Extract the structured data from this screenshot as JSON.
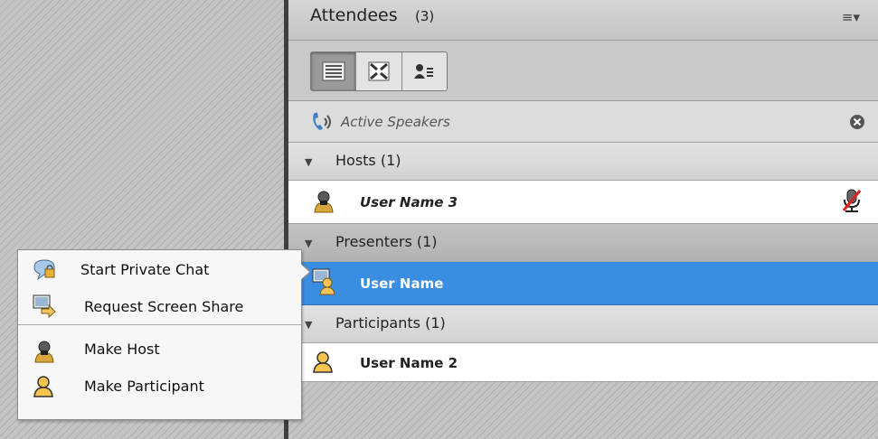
{
  "attendees_pod": {
    "title": "Attendees",
    "count": "(3)",
    "menu_icon": "hamburger-dropdown-icon",
    "view_buttons": [
      {
        "name": "list-view-icon",
        "active": true
      },
      {
        "name": "grid-view-icon",
        "active": false
      },
      {
        "name": "status-view-icon",
        "active": false
      }
    ],
    "active_speakers": {
      "label": "Active Speakers",
      "icon": "phone-speaker-icon"
    },
    "sections": {
      "hosts": {
        "label": "Hosts (1)"
      },
      "presenters": {
        "label": "Presenters (1)"
      },
      "participants": {
        "label": "Participants (1)"
      }
    },
    "users": {
      "host": {
        "name": "User Name 3",
        "icon": "host-user-icon",
        "status_icon": "muted-mic-icon"
      },
      "presenter": {
        "name": "User Name",
        "icon": "presenter-user-icon"
      },
      "participant": {
        "name": "User Name 2",
        "icon": "participant-user-icon"
      }
    }
  },
  "context_menu": {
    "items": [
      {
        "label": "Start Private Chat",
        "icon": "private-chat-icon"
      },
      {
        "label": "Request Screen Share",
        "icon": "screen-share-icon"
      },
      {
        "label": "Make Host",
        "icon": "host-user-icon"
      },
      {
        "label": "Make Participant",
        "icon": "participant-user-icon"
      }
    ]
  },
  "colors": {
    "selection": "#3a8ee2",
    "panel_bg": "#c9c9c9",
    "divider": "#3f3f3f"
  }
}
